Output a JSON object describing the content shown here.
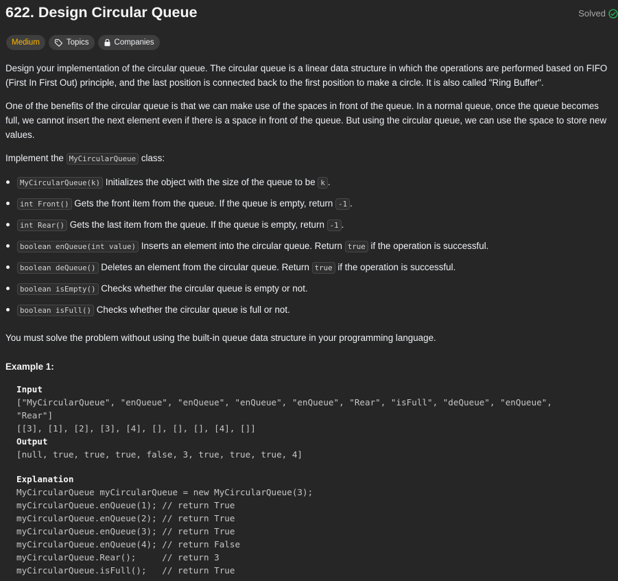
{
  "header": {
    "title": "622. Design Circular Queue",
    "status": "Solved"
  },
  "chips": {
    "difficulty": "Medium",
    "topics": "Topics",
    "companies": "Companies"
  },
  "colors": {
    "difficulty_medium": "#ffb800",
    "solved_check": "#2cbb5d",
    "background": "#262626"
  },
  "description": {
    "p1": "Design your implementation of the circular queue. The circular queue is a linear data structure in which the operations are performed based on FIFO (First In First Out) principle, and the last position is connected back to the first position to make a circle. It is also called \"Ring Buffer\".",
    "p2": "One of the benefits of the circular queue is that we can make use of the spaces in front of the queue. In a normal queue, once the queue becomes full, we cannot insert the next element even if there is a space in front of the queue. But using the circular queue, we can use the space to store new values.",
    "p3_pre": "Implement the ",
    "p3_code": "MyCircularQueue",
    "p3_post": " class:",
    "items": [
      {
        "code": "MyCircularQueue(k)",
        "text": " Initializes the object with the size of the queue to be ",
        "code2": "k",
        "tail": "."
      },
      {
        "code": "int Front()",
        "text": " Gets the front item from the queue. If the queue is empty, return ",
        "code2": "-1",
        "tail": "."
      },
      {
        "code": "int Rear()",
        "text": " Gets the last item from the queue. If the queue is empty, return ",
        "code2": "-1",
        "tail": "."
      },
      {
        "code": "boolean enQueue(int value)",
        "text": " Inserts an element into the circular queue. Return ",
        "code2": "true",
        "tail": " if the operation is successful."
      },
      {
        "code": "boolean deQueue()",
        "text": " Deletes an element from the circular queue. Return ",
        "code2": "true",
        "tail": " if the operation is successful."
      },
      {
        "code": "boolean isEmpty()",
        "text": " Checks whether the circular queue is empty or not.",
        "code2": "",
        "tail": ""
      },
      {
        "code": "boolean isFull()",
        "text": " Checks whether the circular queue is full or not.",
        "code2": "",
        "tail": ""
      }
    ],
    "p4": "You must solve the problem without using the built-in queue data structure in your programming language."
  },
  "example": {
    "heading": "Example 1:",
    "input_label": "Input",
    "input_line1": "[\"MyCircularQueue\", \"enQueue\", \"enQueue\", \"enQueue\", \"enQueue\", \"Rear\", \"isFull\", \"deQueue\", \"enQueue\",",
    "input_line2": "\"Rear\"]",
    "input_line3": "[[3], [1], [2], [3], [4], [], [], [], [4], []]",
    "output_label": "Output",
    "output_line": "[null, true, true, true, false, 3, true, true, true, 4]",
    "explanation_label": "Explanation",
    "explanation_lines": [
      "MyCircularQueue myCircularQueue = new MyCircularQueue(3);",
      "myCircularQueue.enQueue(1); // return True",
      "myCircularQueue.enQueue(2); // return True",
      "myCircularQueue.enQueue(3); // return True",
      "myCircularQueue.enQueue(4); // return False",
      "myCircularQueue.Rear();     // return 3",
      "myCircularQueue.isFull();   // return True"
    ]
  }
}
